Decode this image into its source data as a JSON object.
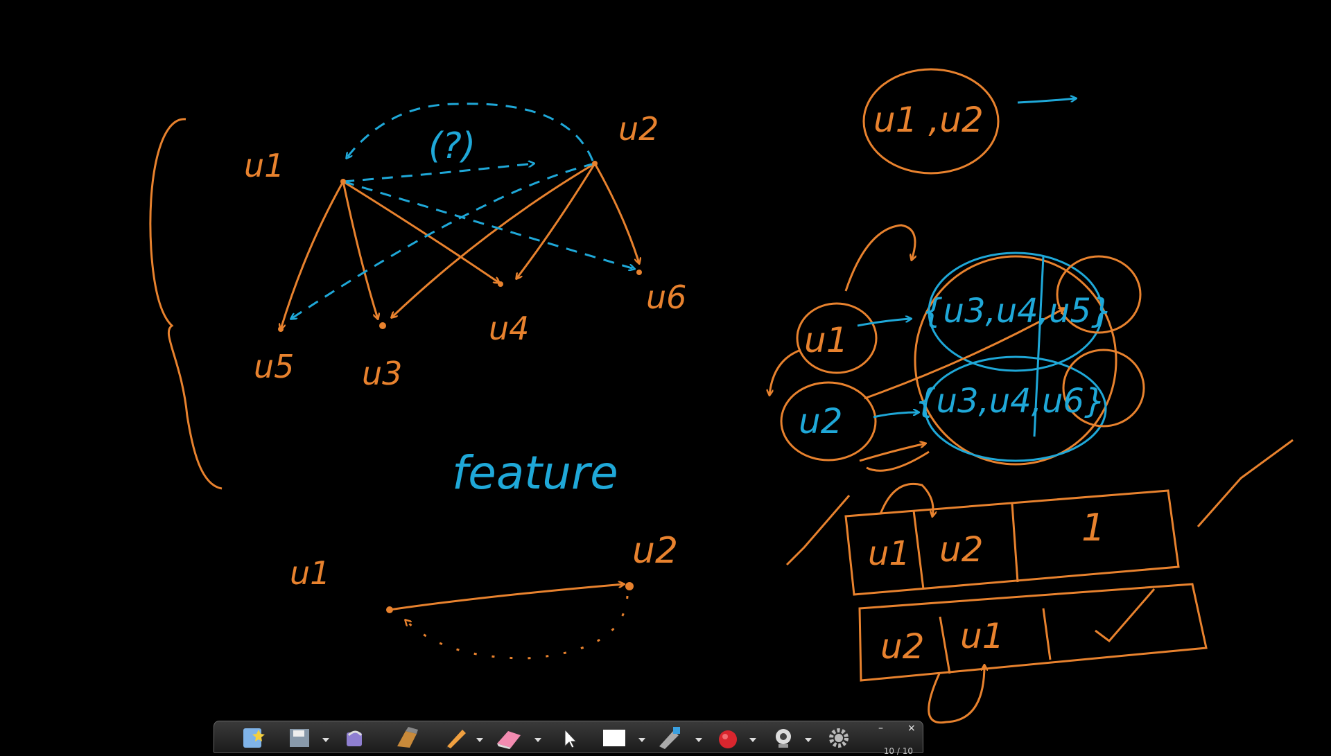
{
  "colors": {
    "background": "#000000",
    "orange": "#E8822E",
    "blue": "#1FA8D8"
  },
  "labels": {
    "u1_top": "u1",
    "u2_top": "u2",
    "question": "(?)",
    "u5": "u5",
    "u3": "u3",
    "u4": "u4",
    "u6": "u6",
    "feature": "feature",
    "u1_bottom": "u1",
    "u2_bottom": "u2",
    "pair": "u1 ,u2",
    "left_u1": "u1",
    "left_u2": "u2",
    "set1": "{u3,u4,u5}",
    "set2": "{u3,u4,u6}",
    "row1_a": "u1",
    "row1_b": "u2",
    "row1_c": "1",
    "row2_a": "u2",
    "row2_b": "u1"
  },
  "toolbar": {
    "page_counter": "10 / 10",
    "minimize": "–",
    "close": "×",
    "tools": [
      "new-page-icon",
      "save-icon",
      "undo-icon",
      "eraser-board-icon",
      "pen-icon",
      "eraser-icon",
      "pointer-icon",
      "screen-icon",
      "highlighter-icon",
      "record-icon",
      "webcam-icon",
      "settings-icon"
    ]
  }
}
